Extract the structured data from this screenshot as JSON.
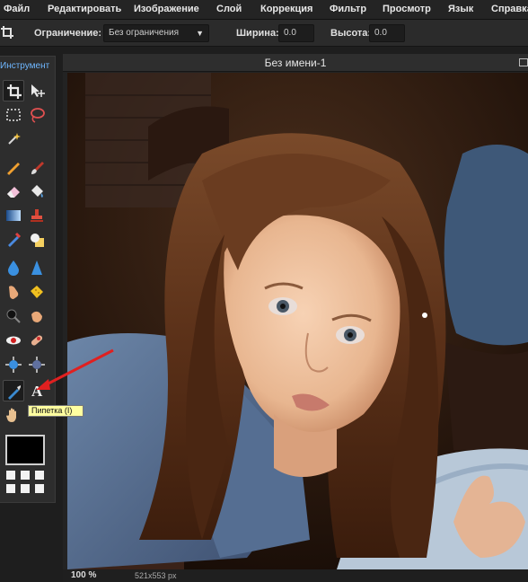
{
  "menu": {
    "items": [
      "Файл",
      "Редактировать",
      "Изображение",
      "Слой",
      "Коррекция",
      "Фильтр",
      "Просмотр",
      "Язык",
      "Справка"
    ]
  },
  "options": {
    "constraint_label": "Ограничение:",
    "constraint_value": "Без ограничения",
    "width_label": "Ширина:",
    "width_value": "0.0",
    "height_label": "Высота:",
    "height_value": "0.0"
  },
  "toolbox": {
    "title": "Инструмент",
    "tools": [
      "crop",
      "move",
      "marquee",
      "lasso",
      "magic-wand",
      "pencil",
      "brush",
      "eraser",
      "paint-bucket",
      "gradient",
      "clone-stamp",
      "color-replace",
      "drawing",
      "blur",
      "sharpen",
      "smudge",
      "sponge",
      "dodge",
      "burn",
      "red-eye",
      "spot-heal",
      "bloat",
      "pinch",
      "eyedropper",
      "type",
      "hand",
      "zoom"
    ],
    "selected_tool": "eyedropper",
    "foreground_color": "#000000"
  },
  "tooltip": {
    "text": "Пипетка (I)"
  },
  "document": {
    "title": "Без имени-1",
    "zoom": "100",
    "zoom_unit": "%",
    "dimensions": "521x553 px"
  },
  "colors": {
    "accent": "#6fb7ff",
    "annotation_arrow": "#e02020"
  }
}
